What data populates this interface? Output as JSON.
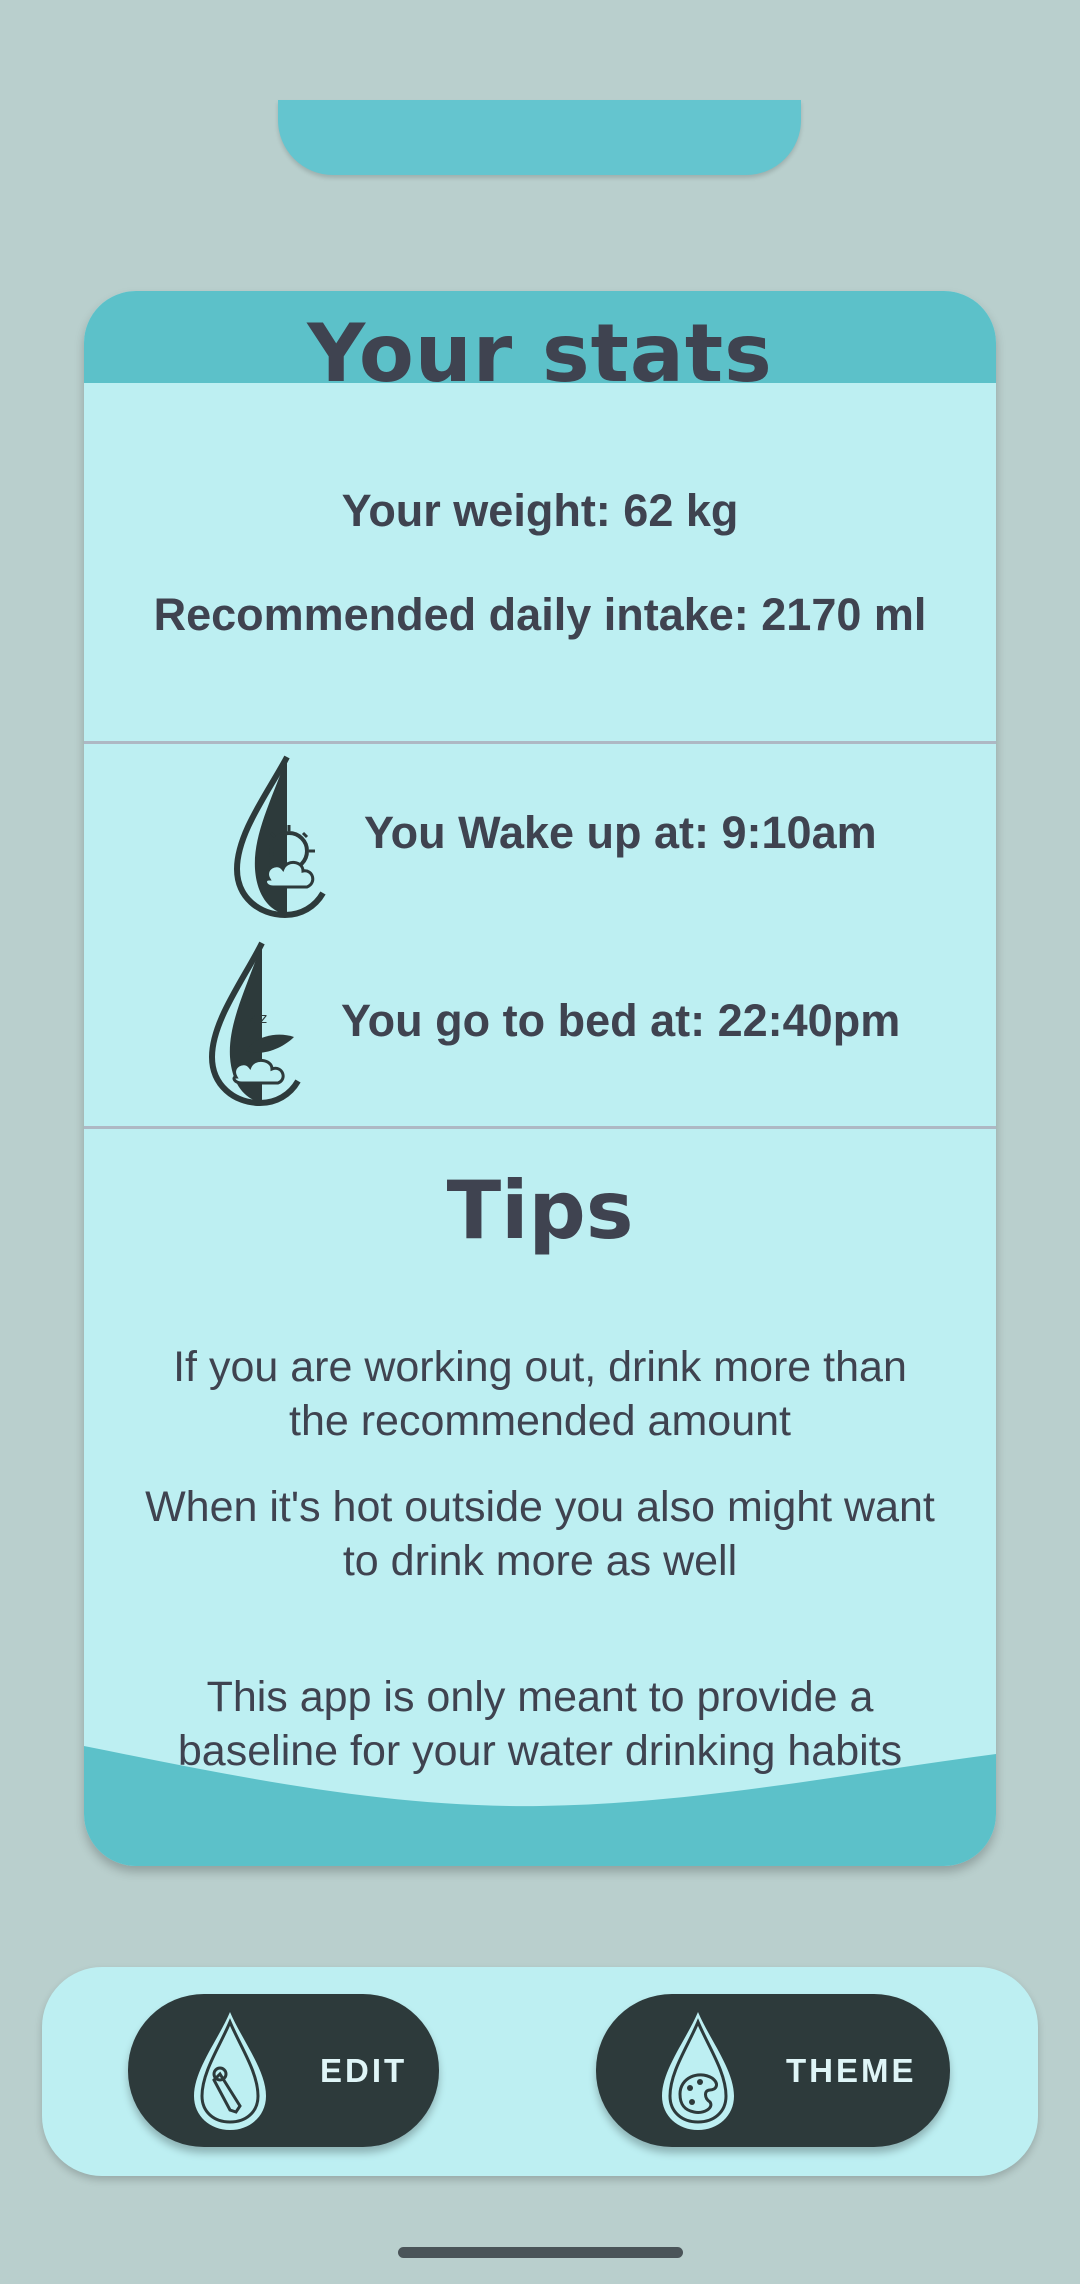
{
  "stats_card": {
    "title": "Your stats",
    "weight_text": "Your weight: 62 kg",
    "intake_text": "Recommended daily intake:  2170 ml"
  },
  "schedule": {
    "wake_text": "You Wake up at:  9:10am",
    "bed_text": "You go to bed at:  22:40pm",
    "wake_icon": "sun-water-drop-icon",
    "bed_icon": "moon-water-drop-icon"
  },
  "tips": {
    "title": "Tips",
    "items": [
      "If you are working out, drink more than the recommended amount",
      "When it's hot outside you also might want to drink more as well"
    ],
    "disclaimer": "This app is only meant to provide a baseline for your water drinking habits"
  },
  "bottom_bar": {
    "edit_label": "EDIT",
    "edit_icon": "pencil-water-drop-icon",
    "theme_label": "THEME",
    "theme_icon": "palette-water-drop-icon"
  },
  "colors": {
    "background": "#b9cfcd",
    "card": "#bdeff2",
    "accent": "#5cc1c9",
    "button": "#2d3a3b",
    "text": "#3f4350"
  }
}
